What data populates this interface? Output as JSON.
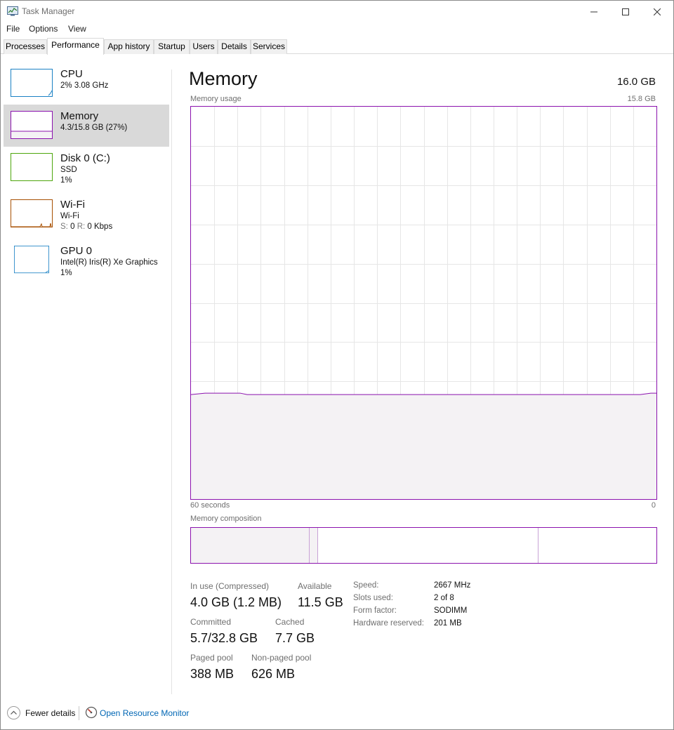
{
  "window": {
    "title": "Task Manager"
  },
  "menu": [
    "File",
    "Options",
    "View"
  ],
  "tabs": [
    "Processes",
    "Performance",
    "App history",
    "Startup",
    "Users",
    "Details",
    "Services"
  ],
  "active_tab": "Performance",
  "sidebar": {
    "items": [
      {
        "title": "CPU",
        "line1": "2%  3.08 GHz",
        "line2": "",
        "accent": "#1a81c4"
      },
      {
        "title": "Memory",
        "line1": "4.3/15.8 GB (27%)",
        "line2": "",
        "accent": "#8b12ae",
        "selected": true
      },
      {
        "title": "Disk 0 (C:)",
        "line1": "SSD",
        "line2": "1%",
        "accent": "#4da60c"
      },
      {
        "title": "Wi-Fi",
        "line1": "Wi-Fi",
        "line2_s": "S:",
        "line2_s_val": "0",
        "line2_r": "R:",
        "line2_r_val": "0 Kbps",
        "accent": "#a74f01"
      },
      {
        "title": "GPU 0",
        "line1": "Intel(R) Iris(R) Xe Graphics",
        "line2": "1%",
        "accent": "#1a81c4"
      }
    ]
  },
  "main": {
    "title": "Memory",
    "total": "16.0 GB",
    "graph_label": "Memory usage",
    "graph_max": "15.8 GB",
    "axis_left": "60 seconds",
    "axis_right": "0",
    "composition_label": "Memory composition",
    "usage_fraction": 0.27,
    "stats": {
      "in_use_label": "In use (Compressed)",
      "in_use_value": "4.0 GB (1.2 MB)",
      "available_label": "Available",
      "available_value": "11.5 GB",
      "committed_label": "Committed",
      "committed_value": "5.7/32.8 GB",
      "cached_label": "Cached",
      "cached_value": "7.7 GB",
      "paged_label": "Paged pool",
      "paged_value": "388 MB",
      "nonpaged_label": "Non-paged pool",
      "nonpaged_value": "626 MB"
    },
    "specs": {
      "speed_label": "Speed:",
      "speed_value": "2667 MHz",
      "slots_label": "Slots used:",
      "slots_value": "2 of 8",
      "form_label": "Form factor:",
      "form_value": "SODIMM",
      "reserved_label": "Hardware reserved:",
      "reserved_value": "201 MB"
    }
  },
  "footer": {
    "fewer_details": "Fewer details",
    "resource_monitor": "Open Resource Monitor"
  },
  "colors": {
    "memory_accent": "#8b12ae",
    "memory_fill": "#f4f2f4",
    "grid": "#e6e6e6",
    "link": "#0066b4"
  }
}
